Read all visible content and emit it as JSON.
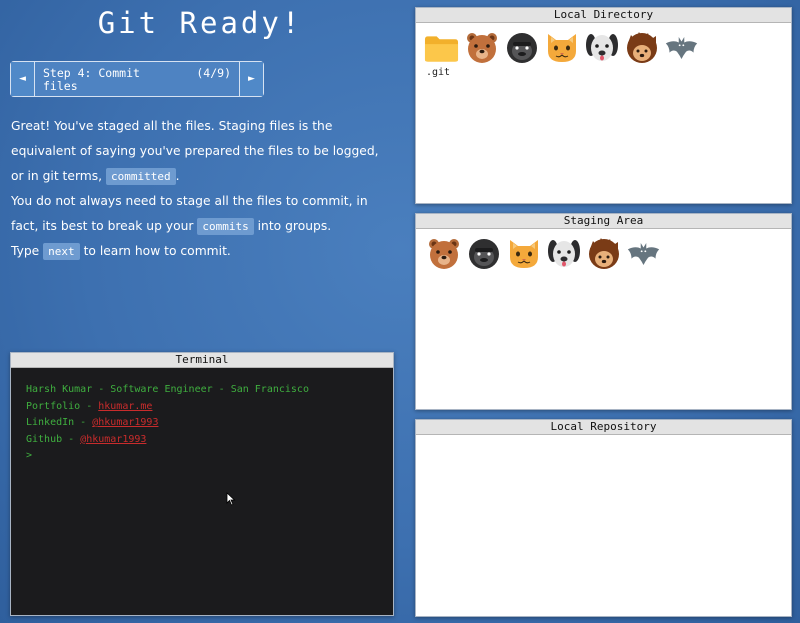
{
  "app_title": "Git Ready!",
  "step": {
    "prev_icon": "◄",
    "next_icon": "►",
    "title_line1": "Step 4: Commit",
    "title_line2": "files",
    "count": "(4/9)"
  },
  "lesson": {
    "p1_text1": "Great! You've staged all the files. Staging files is the equivalent of saying you've prepared the files to be logged, or in git terms, ",
    "p1_code": "committed",
    "p1_text2": ".",
    "p2_text1": "You do not always need to stage all the files to commit, in fact, its best to break up your ",
    "p2_code": "commits",
    "p2_text2": " into groups.",
    "p3_text1": "Type ",
    "p3_code": "next",
    "p3_text2": " to learn how to commit."
  },
  "terminal": {
    "header": "Terminal",
    "line1": "Harsh Kumar - Software Engineer - San Francisco",
    "line2_label": "Portfolio - ",
    "line2_link": "hkumar.me",
    "line3_label": "LinkedIn - ",
    "line3_link": "@hkumar1993",
    "line4_label": "Github - ",
    "line4_link": "@hkumar1993",
    "prompt": ">"
  },
  "local_directory": {
    "header": "Local Directory",
    "folder_label": ".git",
    "files": [
      "folder-icon",
      "bear-icon",
      "gorilla-icon",
      "cat-icon",
      "dog-icon",
      "hedgehog-icon",
      "bat-icon"
    ]
  },
  "staging_area": {
    "header": "Staging Area",
    "files": [
      "bear-icon",
      "gorilla-icon",
      "cat-icon",
      "dog-icon",
      "hedgehog-icon",
      "bat-icon"
    ]
  },
  "local_repository": {
    "header": "Local Repository"
  },
  "colors": {
    "background": "#3d70b0",
    "terminal_bg": "#1b1b1d",
    "terminal_text": "#3fae3f",
    "terminal_link": "#c92c2c"
  }
}
